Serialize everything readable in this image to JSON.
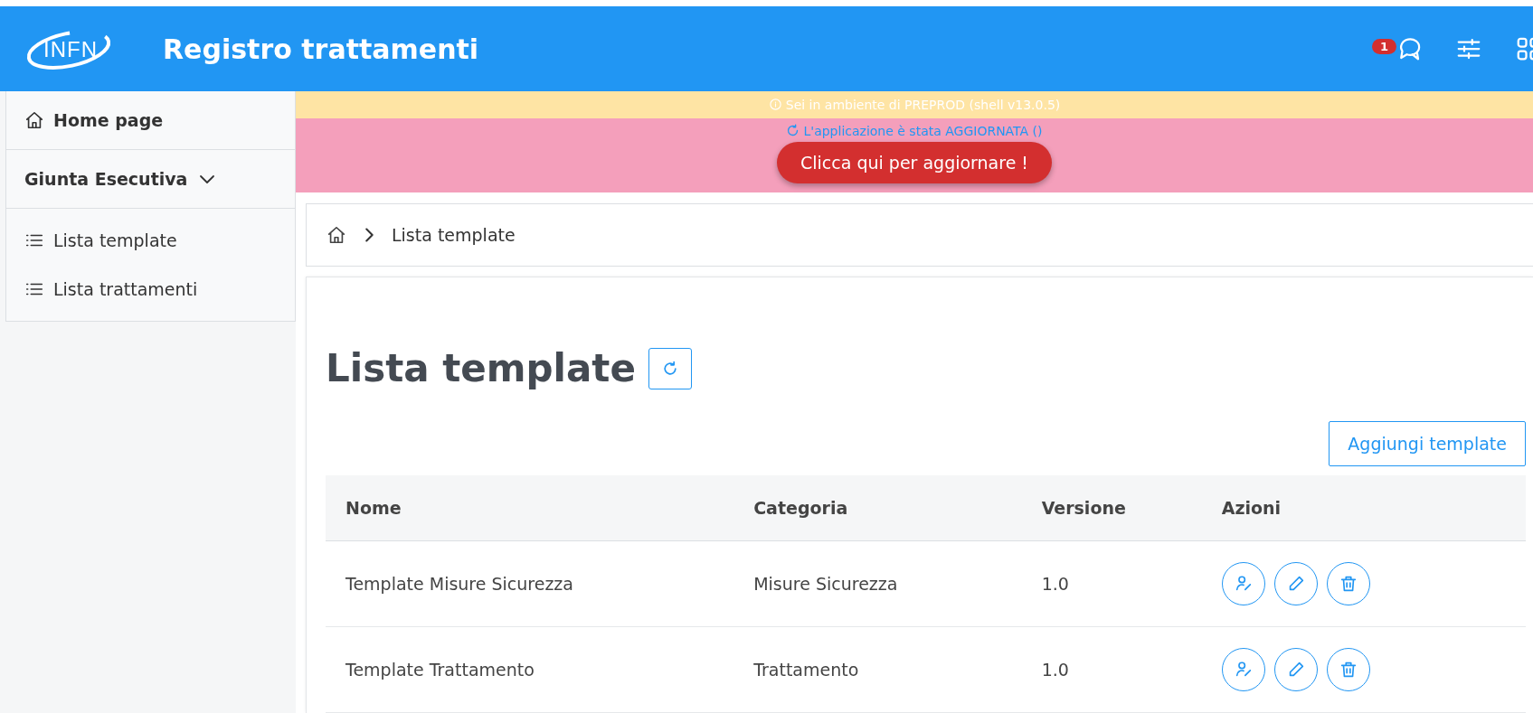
{
  "header": {
    "logo": "INFN",
    "title": "Registro trattamenti",
    "notification_count": "1"
  },
  "sidebar": {
    "home": "Home page",
    "group": {
      "label": "Giunta Esecutiva",
      "expanded": true,
      "children": [
        {
          "label": "Lista template"
        },
        {
          "label": "Lista trattamenti"
        }
      ]
    }
  },
  "env_banner": "Sei in ambiente di PREPROD (shell v13.0.5)",
  "update_banner": {
    "message": "L'applicazione è stata AGGIORNATA ()",
    "button": "Clicca qui per aggiornare !"
  },
  "breadcrumb": [
    "Lista template"
  ],
  "page_title": "Lista template",
  "add_button": "Aggiungi template",
  "table": {
    "columns": [
      "Nome",
      "Categoria",
      "Versione",
      "Azioni"
    ],
    "rows": [
      {
        "cells": [
          "Template Misure Sicurezza",
          "Misure Sicurezza",
          "1.0"
        ]
      },
      {
        "cells": [
          "Template Trattamento",
          "Trattamento",
          "1.0"
        ]
      }
    ]
  }
}
